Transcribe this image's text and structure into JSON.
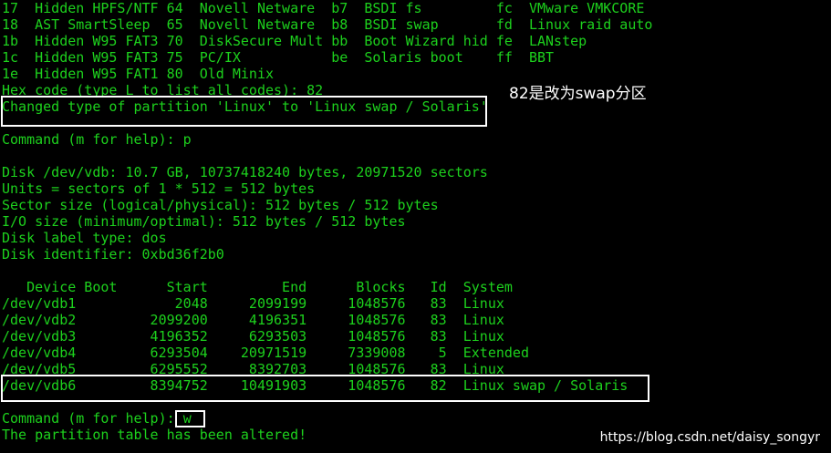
{
  "terminal": {
    "fg_color": "#1dd11d",
    "bg_color": "#000000",
    "type_list": [
      "17  Hidden HPFS/NTF 64  Novell Netware  b7  BSDI fs         fc  VMware VMKCORE",
      "18  AST SmartSleep  65  Novell Netware  b8  BSDI swap       fd  Linux raid auto",
      "1b  Hidden W95 FAT3 70  DiskSecure Mult bb  Boot Wizard hid fe  LANstep",
      "1c  Hidden W95 FAT3 75  PC/IX           be  Solaris boot    ff  BBT",
      "1e  Hidden W95 FAT1 80  Old Minix"
    ],
    "hex_prompt": "Hex code (type L to list all codes): 82",
    "changed_msg": "Changed type of partition 'Linux' to 'Linux swap / Solaris'",
    "cmd_p": "Command (m for help): p",
    "disk_info": [
      "Disk /dev/vdb: 10.7 GB, 10737418240 bytes, 20971520 sectors",
      "Units = sectors of 1 * 512 = 512 bytes",
      "Sector size (logical/physical): 512 bytes / 512 bytes",
      "I/O size (minimum/optimal): 512 bytes / 512 bytes",
      "Disk label type: dos",
      "Disk identifier: 0xbd36f2b0"
    ],
    "table_header": "   Device Boot      Start         End      Blocks   Id  System",
    "table_rows": [
      "/dev/vdb1            2048     2099199     1048576   83  Linux",
      "/dev/vdb2         2099200     4196351     1048576   83  Linux",
      "/dev/vdb3         4196352     6293503     1048576   83  Linux",
      "/dev/vdb4         6293504    20971519     7339008    5  Extended",
      "/dev/vdb5         6295552     8392703     1048576   83  Linux",
      "/dev/vdb6         8394752    10491903     1048576   82  Linux swap / Solaris"
    ],
    "cmd_w_prompt": "Command (m for help): ",
    "cmd_w_input": "w",
    "final_msg": "The partition table has been altered!"
  },
  "annotation": {
    "text": "82是改为swap分区",
    "color": "#ffffff"
  },
  "watermark": {
    "text": "https://blog.csdn.net/daisy_songyr"
  }
}
